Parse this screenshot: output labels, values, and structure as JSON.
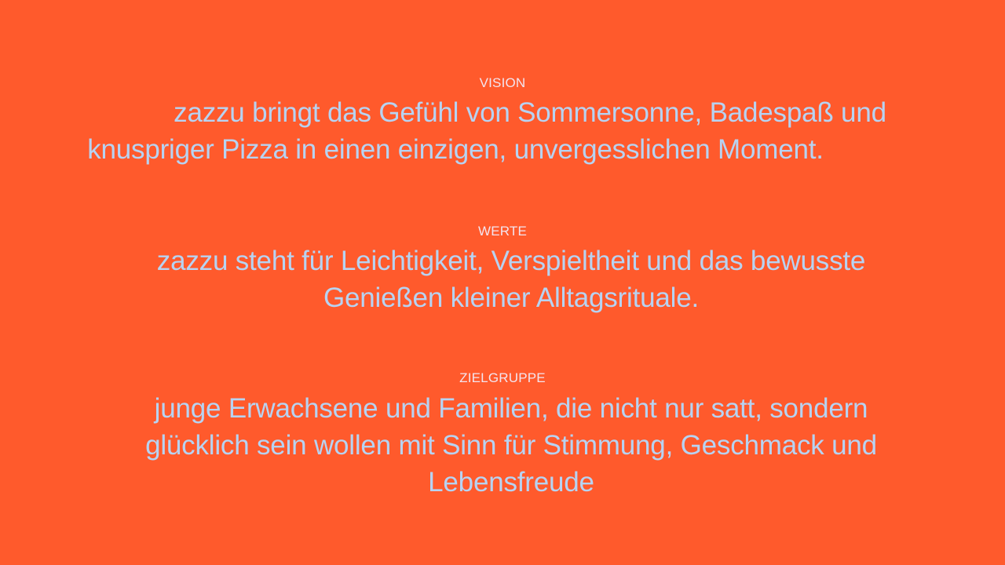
{
  "colors": {
    "background": "#FF5A2C",
    "label": "#F3E4EE",
    "text": "#B7D3F2"
  },
  "sections": {
    "vision": {
      "label": "VISION",
      "lines": [
        "zazzu bringt das Gefühl von Sommersonne, Badespaß und",
        "knuspriger Pizza in einen einzigen, unvergesslichen Moment."
      ]
    },
    "werte": {
      "label": "WERTE",
      "lines": [
        "zazzu steht für Leichtigkeit, Verspieltheit und das bewusste",
        "Genießen kleiner Alltagsrituale."
      ]
    },
    "zielgruppe": {
      "label": "ZIELGRUPPE",
      "lines": [
        "junge Erwachsene und Familien, die nicht nur satt, sondern",
        "glücklich sein wollen mit Sinn für Stimmung, Geschmack und",
        "Lebensfreude"
      ]
    }
  }
}
